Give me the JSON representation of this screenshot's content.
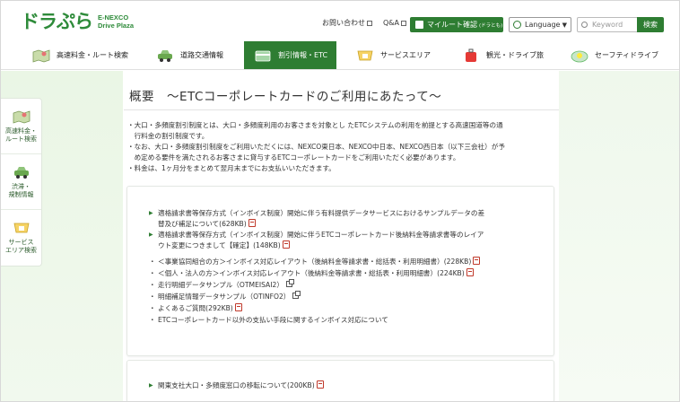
{
  "header": {
    "logo_main": "ドラぷら",
    "logo_sub1": "E-NEXCO",
    "logo_sub2": "Drive Plaza",
    "contact": "お問い合わせ",
    "qa": "Q&A",
    "mylogin": "マイルート確認",
    "mylogin_small": "(ドラとも)",
    "language": "Language",
    "search_placeholder": "Keyword",
    "search_button": "検索"
  },
  "nav": {
    "items": [
      {
        "label": "高速料金・ルート検索",
        "icon": "map-icon"
      },
      {
        "label": "道路交通情報",
        "icon": "car-icon"
      },
      {
        "label": "割引情報・ETC",
        "icon": "card-icon"
      },
      {
        "label": "サービスエリア",
        "icon": "service-area-icon"
      },
      {
        "label": "観光・ドライブ旅",
        "icon": "suitcase-icon"
      },
      {
        "label": "セーフティドライブ",
        "icon": "safety-icon"
      }
    ],
    "active_index": 2
  },
  "sidenav": {
    "items": [
      {
        "label1": "高速料金・",
        "label2": "ルート検索",
        "icon": "map-icon"
      },
      {
        "label1": "渋滞・",
        "label2": "規制情報",
        "icon": "car-icon"
      },
      {
        "label1": "サービス",
        "label2": "エリア検索",
        "icon": "service-area-icon"
      }
    ]
  },
  "main": {
    "title": "概要　～ETCコーポレートカードのご利用にあたって～",
    "intro": [
      "・大口・多頻度割引制度とは、大口・多頻度利用のお客さまを対象とし たETCシステムの利用を前提とする高速国道等の通",
      "　行料金の割引制度です。",
      "・なお、大口・多頻度割引制度をご利用いただくには、NEXCO東日本、NEXCO中日本、NEXCO西日本（以下三会社）が予",
      "　め定める要件を満たされるお客さまに貸与するETCコーポレートカードをご利用いただく必要があります。",
      "・料金は、1ヶ月分をまとめて翌月末までにお支払いいただきます。"
    ],
    "card1": {
      "items": [
        {
          "marker": "▶",
          "line1": "適格請求書等保存方式（インボイス制度）開始に伴う有料提供データサービスにおけるサンプルデータの差",
          "line2": "替及び補足について(628KB)",
          "pdf": true,
          "ext": false
        },
        {
          "marker": "▶",
          "line1": "適格請求書等保存方式（インボイス制度）開始に伴うETCコーポレートカード後納料金等請求書等のレイア",
          "line2": "ウト変更につきまして【確定】(148KB)",
          "pdf": true,
          "ext": false
        },
        {
          "marker": "・",
          "line1": "＜事業協同組合の方＞インボイス対応レイアウト（後納料金等請求書・総括表・利用明細書）(228KB)",
          "line2": "",
          "pdf": true,
          "ext": false
        },
        {
          "marker": "・",
          "line1": "＜個人・法人の方＞インボイス対応レイアウト（後納料金等請求書・総括表・利用明細書）(224KB)",
          "line2": "",
          "pdf": true,
          "ext": false
        },
        {
          "marker": "・",
          "line1": "走行明細データサンプル（OTMEISAI2）",
          "line2": "",
          "pdf": false,
          "ext": true
        },
        {
          "marker": "・",
          "line1": "明細補足情報データサンプル（OTINFO2）",
          "line2": "",
          "pdf": false,
          "ext": true
        },
        {
          "marker": "・",
          "line1": "よくあるご質問(292KB)",
          "line2": "",
          "pdf": true,
          "ext": false
        },
        {
          "marker": "・",
          "line1": "ETCコーポレートカード以外の支払い手段に関するインボイス対応について",
          "line2": "",
          "pdf": false,
          "ext": false
        }
      ]
    },
    "card2": {
      "items": [
        {
          "marker": "▶",
          "line1": "関東支社大口・多頻度窓口の移転について(200KB)",
          "pdf": true
        }
      ]
    }
  },
  "colors": {
    "brand_green": "#2e7d32",
    "logo_green": "#2e8b3a",
    "band_green": "#eaf6e5",
    "pdf_red": "#c0392b"
  }
}
